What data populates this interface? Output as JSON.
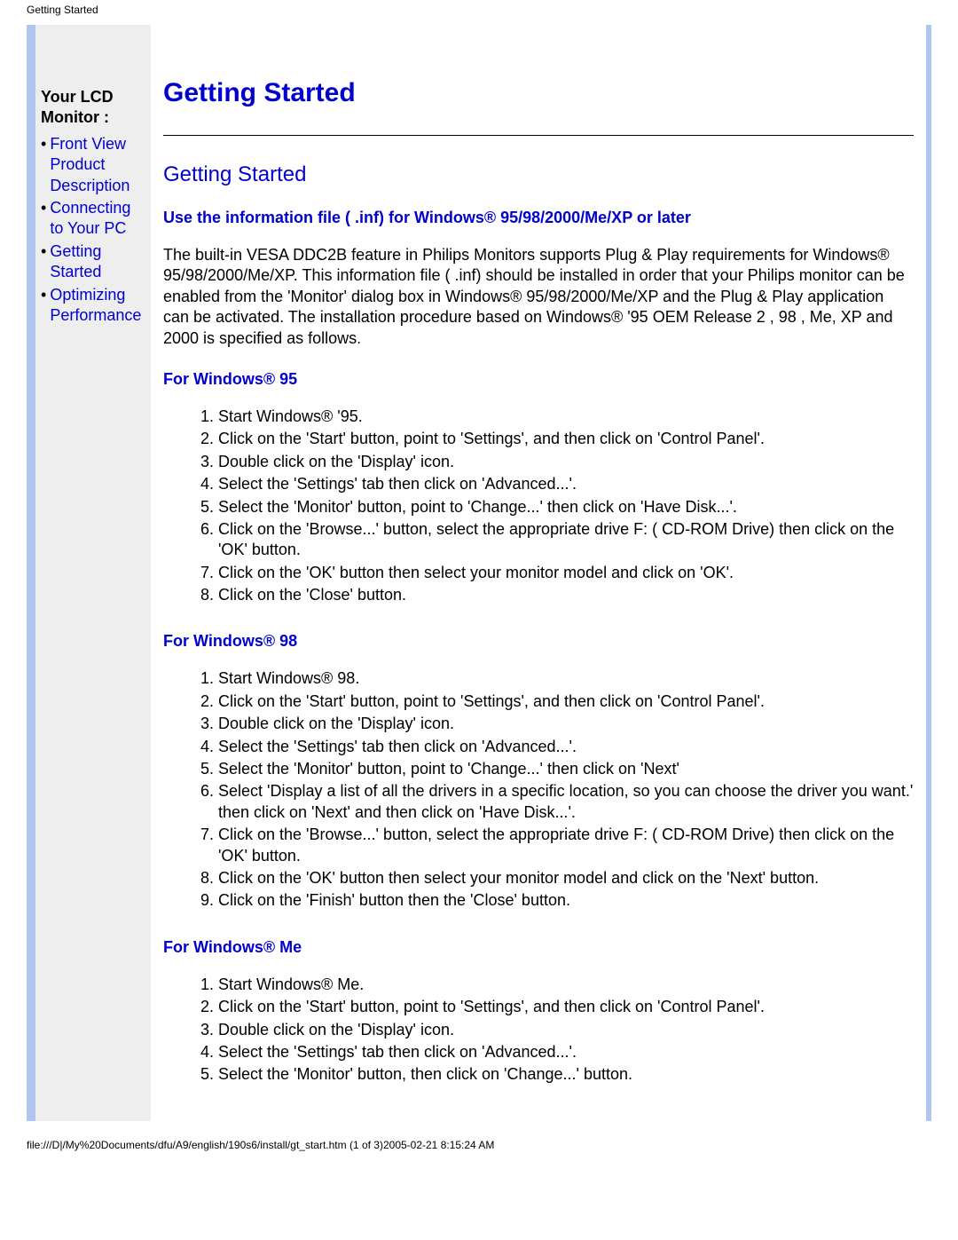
{
  "header_text": "Getting Started",
  "sidebar": {
    "title": "Your LCD Monitor :",
    "items": [
      "Front View Product Description",
      "Connecting to Your PC",
      "Getting Started",
      "Optimizing Performance"
    ]
  },
  "main": {
    "title": "Getting Started",
    "subtitle": "Getting Started",
    "inf_heading": "Use the information file ( .inf) for Windows® 95/98/2000/Me/XP or later",
    "intro_paragraph": "The built-in VESA DDC2B feature in Philips Monitors supports Plug & Play requirements for Windows® 95/98/2000/Me/XP. This information file ( .inf) should be installed in order that your Philips monitor can be enabled from the 'Monitor' dialog box in Windows® 95/98/2000/Me/XP and the Plug & Play application can be activated. The installation procedure based on Windows® '95 OEM Release 2 , 98 , Me, XP and 2000 is specified as follows.",
    "sections": [
      {
        "heading": "For Windows® 95",
        "steps": [
          "Start Windows® '95.",
          "Click on the 'Start' button, point to 'Settings', and then click on 'Control Panel'.",
          "Double click on the 'Display' icon.",
          "Select the 'Settings' tab then click on 'Advanced...'.",
          "Select the 'Monitor' button, point to 'Change...' then click on 'Have Disk...'.",
          "Click on the 'Browse...' button, select the appropriate drive F: ( CD-ROM Drive) then click on the 'OK' button.",
          "Click on the 'OK' button then select your monitor model and click on 'OK'.",
          "Click on the 'Close' button."
        ]
      },
      {
        "heading": "For Windows® 98",
        "steps": [
          "Start Windows® 98.",
          "Click on the 'Start' button, point to 'Settings', and then click on 'Control Panel'.",
          "Double click on the 'Display' icon.",
          "Select the 'Settings' tab then click on 'Advanced...'.",
          "Select the 'Monitor' button, point to 'Change...' then click on 'Next'",
          "Select 'Display a list of all the drivers in a specific location, so you can choose the driver you want.' then click on 'Next' and then click on 'Have Disk...'.",
          "Click on the 'Browse...' button, select the appropriate drive F: ( CD-ROM Drive) then click on the 'OK' button.",
          "Click on the 'OK' button then select your monitor model and click on the 'Next' button.",
          "Click on the 'Finish' button then the 'Close' button."
        ]
      },
      {
        "heading": "For Windows® Me",
        "steps": [
          "Start Windows® Me.",
          "Click on the 'Start' button, point to 'Settings', and then click on 'Control Panel'.",
          "Double click on the 'Display' icon.",
          "Select the 'Settings' tab then click on 'Advanced...'.",
          "Select the 'Monitor' button, then click on 'Change...' button."
        ]
      }
    ]
  },
  "footer_text": "file:///D|/My%20Documents/dfu/A9/english/190s6/install/gt_start.htm (1 of 3)2005-02-21 8:15:24 AM"
}
